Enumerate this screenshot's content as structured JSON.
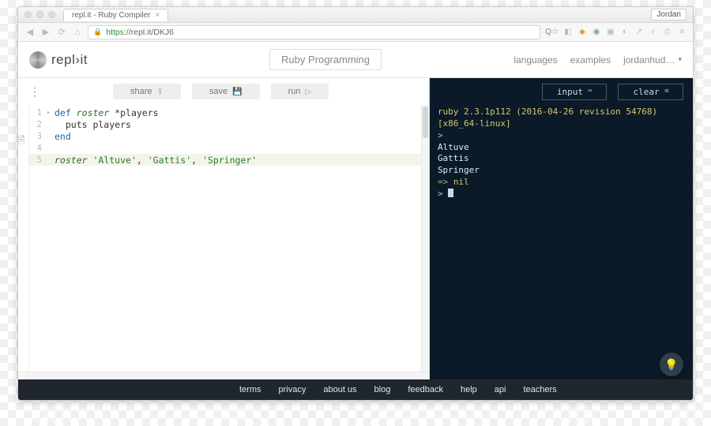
{
  "browser": {
    "tab_title": "repl.it - Ruby Compiler",
    "profile_chip": "Jordan",
    "url_scheme": "https",
    "url_rest": "://repl.it/DKJ6"
  },
  "header": {
    "brand": "repl›it",
    "page_title": "Ruby Programming",
    "nav": {
      "languages": "languages",
      "examples": "examples",
      "user": "jordanhud…"
    }
  },
  "editor": {
    "buttons": {
      "share": "share",
      "save": "save",
      "run": "run"
    },
    "lines": [
      {
        "n": "1",
        "fold": "▸",
        "hl": false,
        "seg": [
          [
            "kw",
            "def"
          ],
          [
            "",
            " "
          ],
          [
            "call",
            "roster"
          ],
          [
            "",
            " *players"
          ]
        ]
      },
      {
        "n": "2",
        "fold": "",
        "hl": false,
        "seg": [
          [
            "",
            "  puts players"
          ]
        ]
      },
      {
        "n": "3",
        "fold": "",
        "hl": false,
        "seg": [
          [
            "kw",
            "end"
          ]
        ]
      },
      {
        "n": "4",
        "fold": "",
        "hl": false,
        "seg": [
          [
            "",
            ""
          ]
        ]
      },
      {
        "n": "5",
        "fold": "",
        "hl": true,
        "seg": [
          [
            "call",
            "roster"
          ],
          [
            "",
            " "
          ],
          [
            "str",
            "'Altuve'"
          ],
          [
            "",
            ", "
          ],
          [
            "str",
            "'Gattis'"
          ],
          [
            "",
            ", "
          ],
          [
            "str",
            "'Springer'"
          ]
        ]
      }
    ]
  },
  "console": {
    "buttons": {
      "input": "input",
      "clear": "clear"
    },
    "version_line": "ruby 2.3.1p112 (2016-04-26 revision 54768)",
    "platform_line": "[x86_64-linux]",
    "output": [
      "Altuve",
      "Gattis",
      "Springer"
    ],
    "ret_arrow": "=> ",
    "ret_val": "nil"
  },
  "footer": {
    "links": [
      "terms",
      "privacy",
      "about us",
      "blog",
      "feedback",
      "help",
      "api",
      "teachers"
    ]
  }
}
